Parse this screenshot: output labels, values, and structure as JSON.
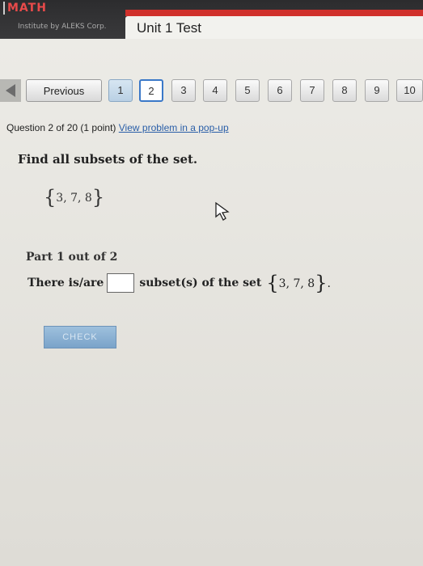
{
  "app": {
    "brand": "MATH",
    "brand_sub": "Institute by ALEKS Corp.",
    "tab_title": "Unit 1 Test"
  },
  "nav": {
    "previous_label": "Previous",
    "pages": [
      "1",
      "2",
      "3",
      "4",
      "5",
      "6",
      "7",
      "8",
      "9",
      "10"
    ],
    "current_page": "2"
  },
  "question": {
    "info": "Question 2 of 20 (1 point)",
    "popup_link": "View problem in a pop-up",
    "instruction": "Find all subsets of the set.",
    "set_open": "{",
    "set_elements": "3, 7, 8",
    "set_close": "}",
    "part_label": "Part 1 out of 2",
    "answer_prefix": "There is/are",
    "answer_value": "",
    "answer_suffix": "subset(s) of the set",
    "answer_end": "."
  },
  "actions": {
    "check_label": "CHECK"
  },
  "colors": {
    "accent_red": "#d0302b",
    "link_blue": "#2a5ea8",
    "current_page_border": "#3a78c8",
    "check_button": "#7aa3c9"
  }
}
